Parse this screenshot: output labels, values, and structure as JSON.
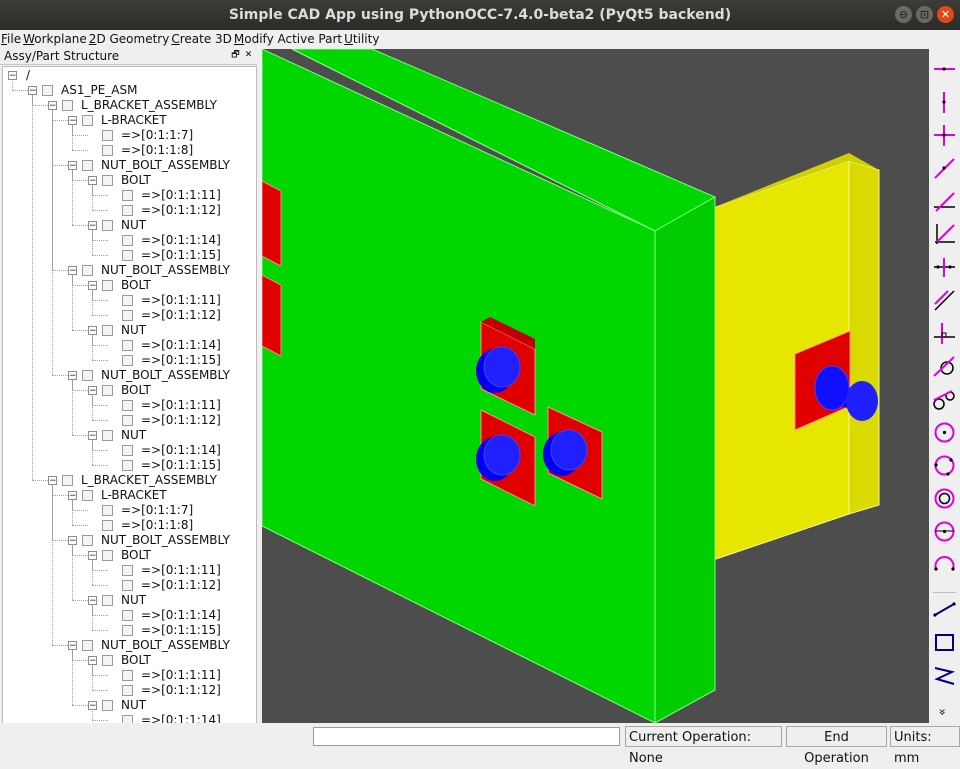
{
  "window": {
    "title": "Simple CAD App using PythonOCC-7.4.0-beta2 (PyQt5 backend)",
    "controls": [
      "⊖",
      "⊡",
      "✕"
    ]
  },
  "menubar": [
    "File",
    "Workplane",
    "2D Geometry",
    "Create 3D",
    "Modify Active Part",
    "Utility"
  ],
  "dock": {
    "title": "Assy/Part Structure",
    "float_glyph": "🗗",
    "close_glyph": "✕"
  },
  "tree": [
    {
      "label": "/",
      "depth": 0,
      "expander": "⊟",
      "checkbox": false
    },
    {
      "label": "AS1_PE_ASM",
      "depth": 1,
      "expander": "⊟",
      "checkbox": true
    },
    {
      "label": "L_BRACKET_ASSEMBLY",
      "depth": 2,
      "expander": "⊟",
      "checkbox": true
    },
    {
      "label": "L-BRACKET",
      "depth": 3,
      "expander": "⊟",
      "checkbox": true
    },
    {
      "label": "=>[0:1:1:7]",
      "depth": 4,
      "expander": "",
      "checkbox": true
    },
    {
      "label": "=>[0:1:1:8]",
      "depth": 4,
      "expander": "",
      "checkbox": true
    },
    {
      "label": "NUT_BOLT_ASSEMBLY",
      "depth": 3,
      "expander": "⊟",
      "checkbox": true
    },
    {
      "label": "BOLT",
      "depth": 4,
      "expander": "⊟",
      "checkbox": true
    },
    {
      "label": "=>[0:1:1:11]",
      "depth": 5,
      "expander": "",
      "checkbox": true
    },
    {
      "label": "=>[0:1:1:12]",
      "depth": 5,
      "expander": "",
      "checkbox": true
    },
    {
      "label": "NUT",
      "depth": 4,
      "expander": "⊟",
      "checkbox": true
    },
    {
      "label": "=>[0:1:1:14]",
      "depth": 5,
      "expander": "",
      "checkbox": true
    },
    {
      "label": "=>[0:1:1:15]",
      "depth": 5,
      "expander": "",
      "checkbox": true
    },
    {
      "label": "NUT_BOLT_ASSEMBLY",
      "depth": 3,
      "expander": "⊟",
      "checkbox": true
    },
    {
      "label": "BOLT",
      "depth": 4,
      "expander": "⊟",
      "checkbox": true
    },
    {
      "label": "=>[0:1:1:11]",
      "depth": 5,
      "expander": "",
      "checkbox": true
    },
    {
      "label": "=>[0:1:1:12]",
      "depth": 5,
      "expander": "",
      "checkbox": true
    },
    {
      "label": "NUT",
      "depth": 4,
      "expander": "⊟",
      "checkbox": true
    },
    {
      "label": "=>[0:1:1:14]",
      "depth": 5,
      "expander": "",
      "checkbox": true
    },
    {
      "label": "=>[0:1:1:15]",
      "depth": 5,
      "expander": "",
      "checkbox": true
    },
    {
      "label": "NUT_BOLT_ASSEMBLY",
      "depth": 3,
      "expander": "⊟",
      "checkbox": true
    },
    {
      "label": "BOLT",
      "depth": 4,
      "expander": "⊟",
      "checkbox": true
    },
    {
      "label": "=>[0:1:1:11]",
      "depth": 5,
      "expander": "",
      "checkbox": true
    },
    {
      "label": "=>[0:1:1:12]",
      "depth": 5,
      "expander": "",
      "checkbox": true
    },
    {
      "label": "NUT",
      "depth": 4,
      "expander": "⊟",
      "checkbox": true
    },
    {
      "label": "=>[0:1:1:14]",
      "depth": 5,
      "expander": "",
      "checkbox": true
    },
    {
      "label": "=>[0:1:1:15]",
      "depth": 5,
      "expander": "",
      "checkbox": true
    },
    {
      "label": "L_BRACKET_ASSEMBLY",
      "depth": 2,
      "expander": "⊟",
      "checkbox": true
    },
    {
      "label": "L-BRACKET",
      "depth": 3,
      "expander": "⊟",
      "checkbox": true
    },
    {
      "label": "=>[0:1:1:7]",
      "depth": 4,
      "expander": "",
      "checkbox": true
    },
    {
      "label": "=>[0:1:1:8]",
      "depth": 4,
      "expander": "",
      "checkbox": true
    },
    {
      "label": "NUT_BOLT_ASSEMBLY",
      "depth": 3,
      "expander": "⊟",
      "checkbox": true
    },
    {
      "label": "BOLT",
      "depth": 4,
      "expander": "⊟",
      "checkbox": true
    },
    {
      "label": "=>[0:1:1:11]",
      "depth": 5,
      "expander": "",
      "checkbox": true
    },
    {
      "label": "=>[0:1:1:12]",
      "depth": 5,
      "expander": "",
      "checkbox": true
    },
    {
      "label": "NUT",
      "depth": 4,
      "expander": "⊟",
      "checkbox": true
    },
    {
      "label": "=>[0:1:1:14]",
      "depth": 5,
      "expander": "",
      "checkbox": true
    },
    {
      "label": "=>[0:1:1:15]",
      "depth": 5,
      "expander": "",
      "checkbox": true
    },
    {
      "label": "NUT_BOLT_ASSEMBLY",
      "depth": 3,
      "expander": "⊟",
      "checkbox": true
    },
    {
      "label": "BOLT",
      "depth": 4,
      "expander": "⊟",
      "checkbox": true
    },
    {
      "label": "=>[0:1:1:11]",
      "depth": 5,
      "expander": "",
      "checkbox": true
    },
    {
      "label": "=>[0:1:1:12]",
      "depth": 5,
      "expander": "",
      "checkbox": true
    },
    {
      "label": "NUT",
      "depth": 4,
      "expander": "⊟",
      "checkbox": true
    },
    {
      "label": "=>[0:1:1:14]",
      "depth": 5,
      "expander": "",
      "checkbox": true
    }
  ],
  "toolbar": {
    "tools": [
      "horizontal-line-icon",
      "vertical-line-icon",
      "horizontal-vertical-line-icon",
      "angled-line-icon",
      "line-at-angle-icon",
      "bisector-line-icon",
      "perpendicular-lines-icon",
      "parallel-line-icon",
      "perpendicular-line-icon",
      "line-tangent-to-circle-icon",
      "line-tangent-two-circles-icon",
      "circle-icon",
      "circle-three-points-icon",
      "concentric-circle-icon",
      "circle-tangent-icon",
      "arc-icon"
    ],
    "tools2": [
      "segment-icon",
      "rectangle-icon",
      "polyline-icon"
    ],
    "more_glyph": "»"
  },
  "status": {
    "input_value": "",
    "current_operation": "Current Operation: None",
    "end_operation": "End Operation",
    "units": "Units: mm"
  },
  "colors": {
    "viewport_bg": "#4d4d4d",
    "bracket_green": "#00d600",
    "bracket_yellow": "#e6e600",
    "nut_red": "#e00000",
    "bolt_blue": "#0000ff",
    "tool_magenta": "#e000e0"
  }
}
